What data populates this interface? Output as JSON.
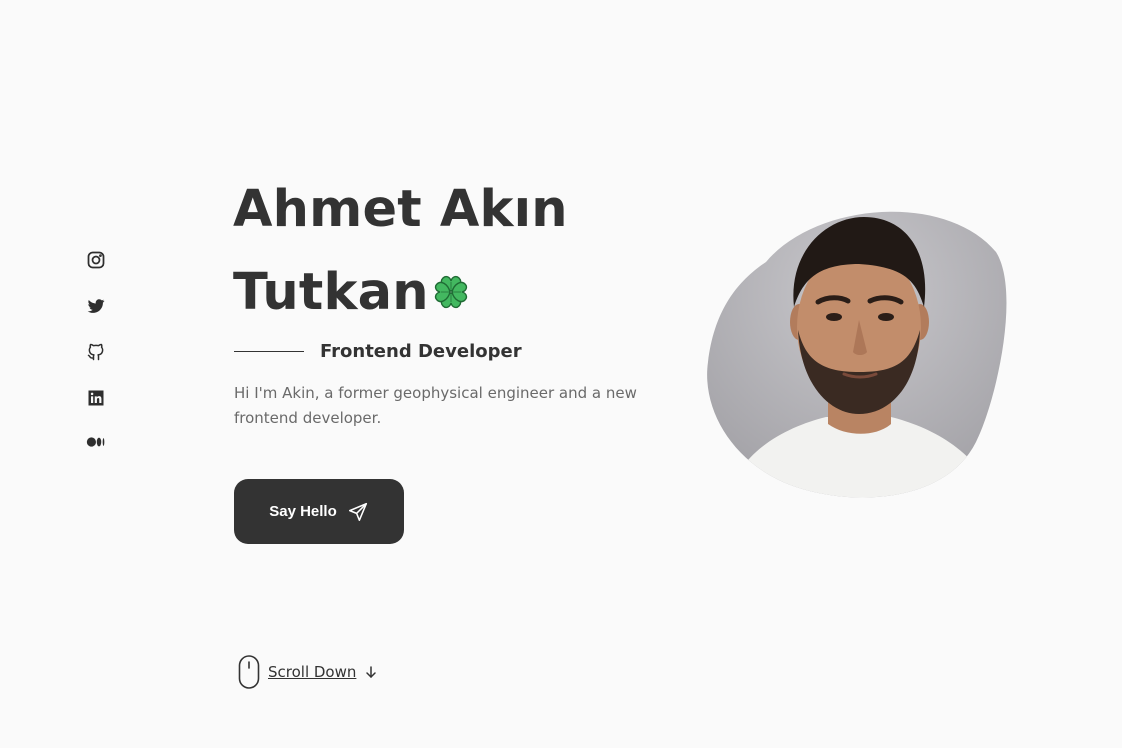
{
  "social": [
    {
      "name": "instagram"
    },
    {
      "name": "twitter"
    },
    {
      "name": "github"
    },
    {
      "name": "linkedin"
    },
    {
      "name": "medium"
    }
  ],
  "hero": {
    "title_line1": "Ahmet Akın",
    "title_line2": "Tutkan",
    "title_emoji": "four-leaf-clover-icon",
    "subtitle": "Frontend Developer",
    "description": "Hi I'm Akin, a former geophysical engineer and a new frontend developer.",
    "cta_label": "Say Hello"
  },
  "scroll": {
    "label": "Scroll Down"
  },
  "colors": {
    "background": "#fafafa",
    "text": "#333333",
    "muted": "#6a6a6a",
    "button": "#333333",
    "clover": "#43b860"
  }
}
